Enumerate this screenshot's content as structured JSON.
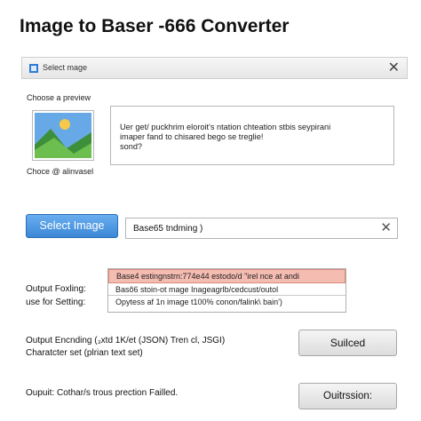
{
  "app": {
    "title": "Image to Baser -666 Converter"
  },
  "dialog": {
    "title": "Select mage"
  },
  "preview": {
    "label": "Choose a preview",
    "choose_label": "Choce @ alinvasel"
  },
  "description": {
    "text": "Uer get/ puckhrim eloroit's ntation chteation stbis seypirani\nimaper fand to chisared bego se treglie!\nsond?"
  },
  "actions": {
    "select_image_label": "Select Image",
    "encoding_field_value": "Base65 tndming )",
    "suiced_label": "Suilced",
    "ouitrssion_label": "Ouitrssion:"
  },
  "output": {
    "label_line1": "Output Foxling:",
    "label_line2": "use for Setting:",
    "options": [
      "Base4 estingnstrn:774e44 estodo/d \"irel nce at  andi",
      "Basõ6 stoin-ot mage Inageagrlb/cedcust/outol",
      "Opytess af 1n image t100% conon/falink\\ bain')"
    ],
    "selected_index": 0
  },
  "encoding": {
    "line1": "Output Encnding (₃xtd 1K/et (JSON) Tren cl, JSGI)",
    "line2": "Charatcter set (plrian text set)"
  },
  "status": {
    "text": "Oupuit: Cothar/s trous prection Failled."
  },
  "colors": {
    "primary_button": "#3b87d6",
    "selected_option": "#f5bcb2",
    "window_icon": "#2f7ad8"
  },
  "icons": {
    "dialog_icon": "window-icon",
    "close": "close-icon",
    "clear": "clear-icon",
    "preview": "landscape-image-icon"
  }
}
